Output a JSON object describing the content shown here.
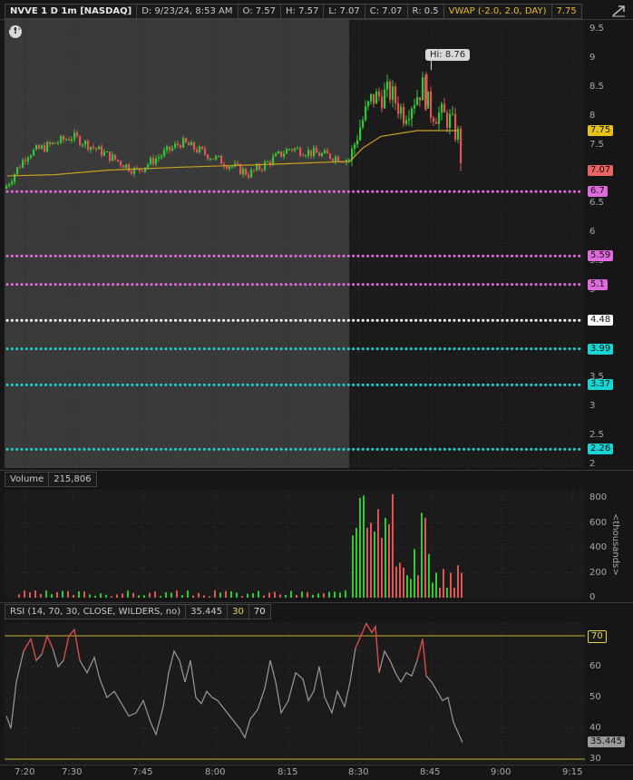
{
  "header": {
    "symbol": "NVVE 1 D 1m [NASDAQ]",
    "date": "D: 9/23/24, 8:53 AM",
    "open": "O: 7.57",
    "high": "H: 7.57",
    "low": "L: 7.07",
    "close": "C: 7.07",
    "range": "R: 0.5",
    "vwap_label": "VWAP (-2.0, 2.0, DAY)",
    "vwap_value": "7.75"
  },
  "volume_header": {
    "label": "Volume",
    "value": "215,806"
  },
  "rsi_header": {
    "label": "RSI (14, 70, 30, CLOSE, WILDERS, no)",
    "value": "35.445",
    "low": "30",
    "high": "70"
  },
  "hi_callout": "Hi: 8.76",
  "price_axis": [
    "9.5",
    "9",
    "8.5",
    "8",
    "7.5",
    "7",
    "6.5",
    "6",
    "5.5",
    "5",
    "4.5",
    "4",
    "3.5",
    "3",
    "2.5",
    "2"
  ],
  "volume_axis": [
    "800",
    "600",
    "400",
    "200",
    "0"
  ],
  "volume_unit": "<thousands>",
  "rsi_axis": [
    "70",
    "60",
    "50",
    "40",
    "30"
  ],
  "time_axis": [
    "7:20",
    "7:30",
    "7:45",
    "8:00",
    "8:15",
    "8:30",
    "8:45",
    "9:00",
    "9:15"
  ],
  "price_tags": {
    "vwap": {
      "text": "7.75",
      "color": "#e7c21a"
    },
    "last": {
      "text": "7.07",
      "color": "#e86464"
    },
    "rsi_value": {
      "text": "35.445",
      "color": "#9a9a9a"
    }
  },
  "levels": [
    {
      "value": 6.7,
      "label": "6.7",
      "color": "#e06bdc"
    },
    {
      "value": 5.59,
      "label": "5.59",
      "color": "#e06bdc"
    },
    {
      "value": 5.1,
      "label": "5.1",
      "color": "#e06bdc"
    },
    {
      "value": 4.48,
      "label": "4.48",
      "color": "#ffffff"
    },
    {
      "value": 3.99,
      "label": "3.99",
      "color": "#18d4d4"
    },
    {
      "value": 3.37,
      "label": "3.37",
      "color": "#18d4d4"
    },
    {
      "value": 2.26,
      "label": "2.26",
      "color": "#18d4d4"
    }
  ],
  "colors": {
    "up": "#32c832",
    "down": "#e05555",
    "vwap": "#c8a020",
    "rsi": "#9a9a9a",
    "rsi_hot": "#d44",
    "rsi_band": "#c8b030"
  }
}
